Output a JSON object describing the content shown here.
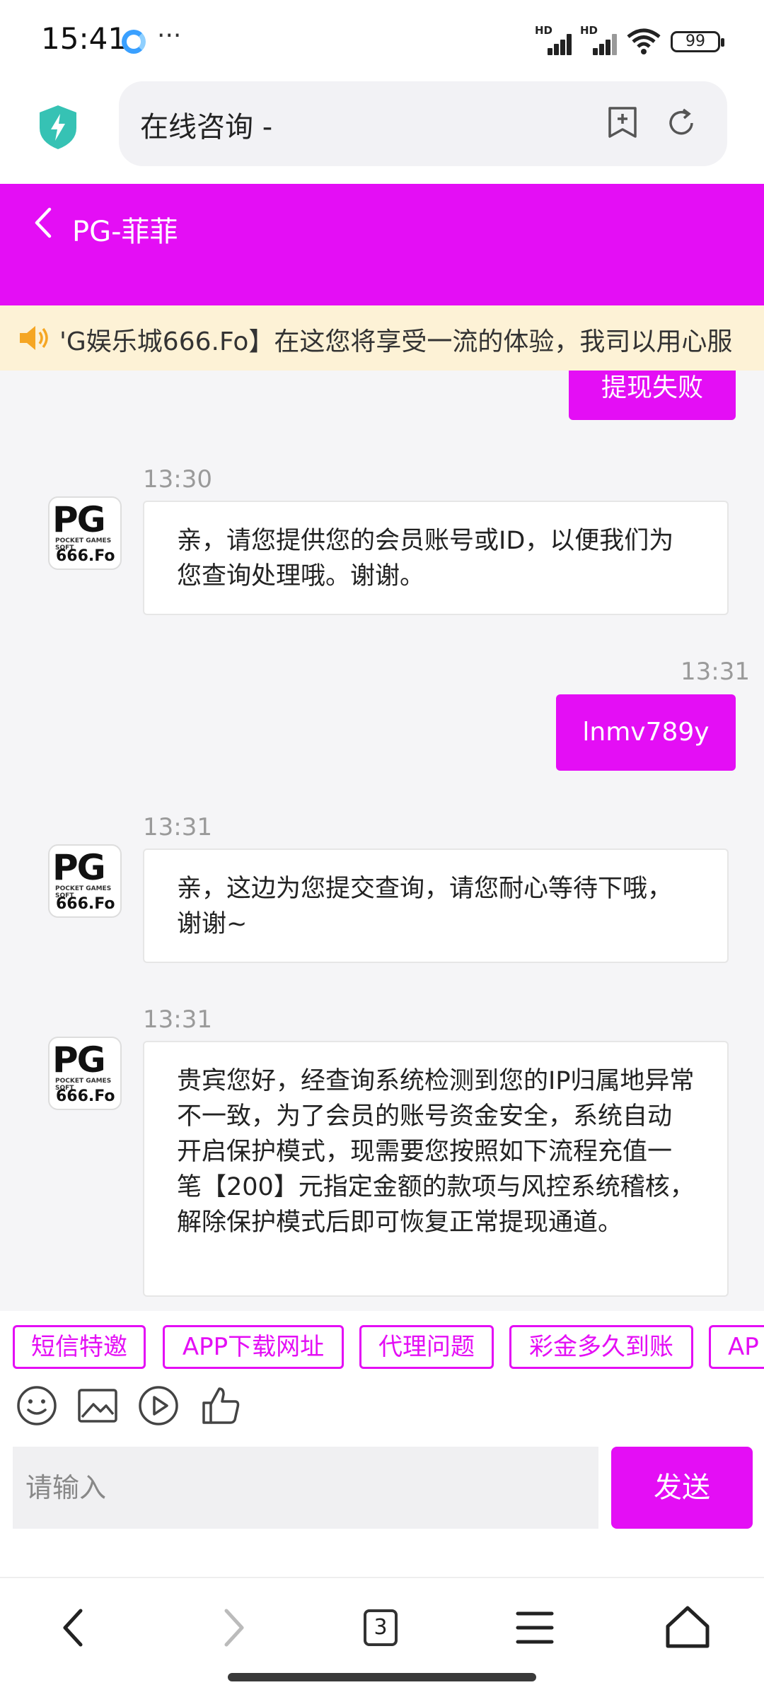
{
  "status_bar": {
    "time": "15:41",
    "dots": "···",
    "signal_1_label": "HD",
    "signal_2_label": "HD",
    "battery": "99",
    "icons": [
      "app-notification-icon",
      "signal-icon",
      "wifi-icon",
      "battery-icon"
    ]
  },
  "browser": {
    "url_title": "在线咨询 -",
    "icons": [
      "shield-icon",
      "add-bookmark-icon",
      "refresh-icon"
    ]
  },
  "chat_header": {
    "title": "PG-菲菲",
    "background": "#e40ef5"
  },
  "notice": {
    "text": "'G娱乐城666.Fo】在这您将享受一流的体验，我司以用心服"
  },
  "messages": [
    {
      "side": "right",
      "text": "提现失败"
    },
    {
      "side": "left",
      "time": "13:30",
      "text": "亲，请您提供您的会员账号或ID，以便我们为您查询处理哦。谢谢。"
    },
    {
      "side": "right",
      "time": "13:31",
      "text": "lnmv789y"
    },
    {
      "side": "left",
      "time": "13:31",
      "text": "亲，这边为您提交查询，请您耐心等待下哦，谢谢~"
    },
    {
      "side": "left",
      "time": "13:31",
      "text": "贵宾您好，经查询系统检测到您的IP归属地异常不一致，为了会员的账号资金安全，系统自动开启保护模式，现需要您按照如下流程充值一笔【200】元指定金额的款项与风控系统稽核，解除保护模式后即可恢复正常提现通道。"
    }
  ],
  "avatar": {
    "logo_text": "PG",
    "logo_sub": "POCKET GAMES SOFT",
    "logo_domain": "666.Fo"
  },
  "quick_replies": [
    "短信特邀",
    "APP下载网址",
    "代理问题",
    "彩金多久到账",
    "AP"
  ],
  "tools": [
    "emoji-icon",
    "image-icon",
    "video-icon",
    "thumbs-up-icon"
  ],
  "input": {
    "placeholder": "请输入",
    "value": "",
    "send_label": "发送"
  },
  "bottom_nav": {
    "tab_count": "3",
    "icons": [
      "back-icon",
      "forward-icon",
      "tabs-icon",
      "menu-icon",
      "home-icon"
    ]
  }
}
